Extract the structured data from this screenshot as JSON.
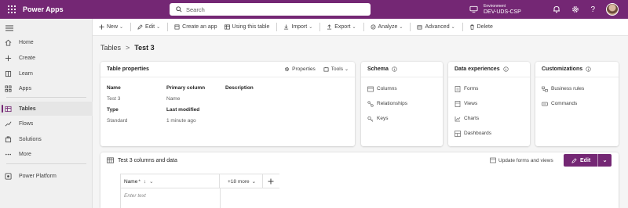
{
  "app": {
    "title": "Power Apps"
  },
  "search": {
    "placeholder": "Search"
  },
  "environment": {
    "label": "Environment",
    "name": "DEV-UDS-CSP"
  },
  "commands": [
    {
      "label": "New",
      "icon": "plus-icon",
      "dropdown": true
    },
    {
      "label": "Edit",
      "icon": "pencil-icon",
      "dropdown": true
    },
    {
      "label": "Create an app",
      "icon": "app-icon",
      "dropdown": false
    },
    {
      "label": "Using this table",
      "icon": "table-icon",
      "dropdown": false
    },
    {
      "label": "Import",
      "icon": "import-icon",
      "dropdown": true
    },
    {
      "label": "Export",
      "icon": "export-icon",
      "dropdown": true
    },
    {
      "label": "Analyze",
      "icon": "analyze-icon",
      "dropdown": true
    },
    {
      "label": "Advanced",
      "icon": "advanced-icon",
      "dropdown": true
    },
    {
      "label": "Delete",
      "icon": "trash-icon",
      "dropdown": false
    }
  ],
  "sidebar": {
    "items": [
      {
        "label": "Home",
        "icon": "home-icon"
      },
      {
        "label": "Create",
        "icon": "plus-icon"
      },
      {
        "label": "Learn",
        "icon": "book-icon"
      },
      {
        "label": "Apps",
        "icon": "apps-icon"
      },
      {
        "label": "Tables",
        "icon": "table-icon",
        "active": true
      },
      {
        "label": "Flows",
        "icon": "flow-icon"
      },
      {
        "label": "Solutions",
        "icon": "solutions-icon"
      },
      {
        "label": "More",
        "icon": "more-icon"
      },
      {
        "label": "Power Platform",
        "icon": "power-platform-icon"
      }
    ]
  },
  "breadcrumb": {
    "parent": "Tables",
    "separator": ">",
    "current": "Test 3"
  },
  "table_properties": {
    "title": "Table properties",
    "properties_label": "Properties",
    "tools_label": "Tools",
    "fields": {
      "name_label": "Name",
      "name_value": "Test 3",
      "primary_column_label": "Primary column",
      "primary_column_value": "Name",
      "description_label": "Description",
      "type_label": "Type",
      "type_value": "Standard",
      "last_modified_label": "Last modified",
      "last_modified_value": "1 minute ago"
    }
  },
  "schema": {
    "title": "Schema",
    "items": [
      "Columns",
      "Relationships",
      "Keys"
    ]
  },
  "data_experiences": {
    "title": "Data experiences",
    "items": [
      "Forms",
      "Views",
      "Charts",
      "Dashboards"
    ]
  },
  "customizations": {
    "title": "Customizations",
    "items": [
      "Business rules",
      "Commands"
    ]
  },
  "data_section": {
    "title": "Test 3 columns and data",
    "update_label": "Update forms and views",
    "edit_label": "Edit",
    "column_name": "Name",
    "required_mark": "*",
    "more_columns": "+18 more",
    "enter_text": "Enter text"
  },
  "colors": {
    "brand": "#742774",
    "background": "#f5f5f5"
  }
}
